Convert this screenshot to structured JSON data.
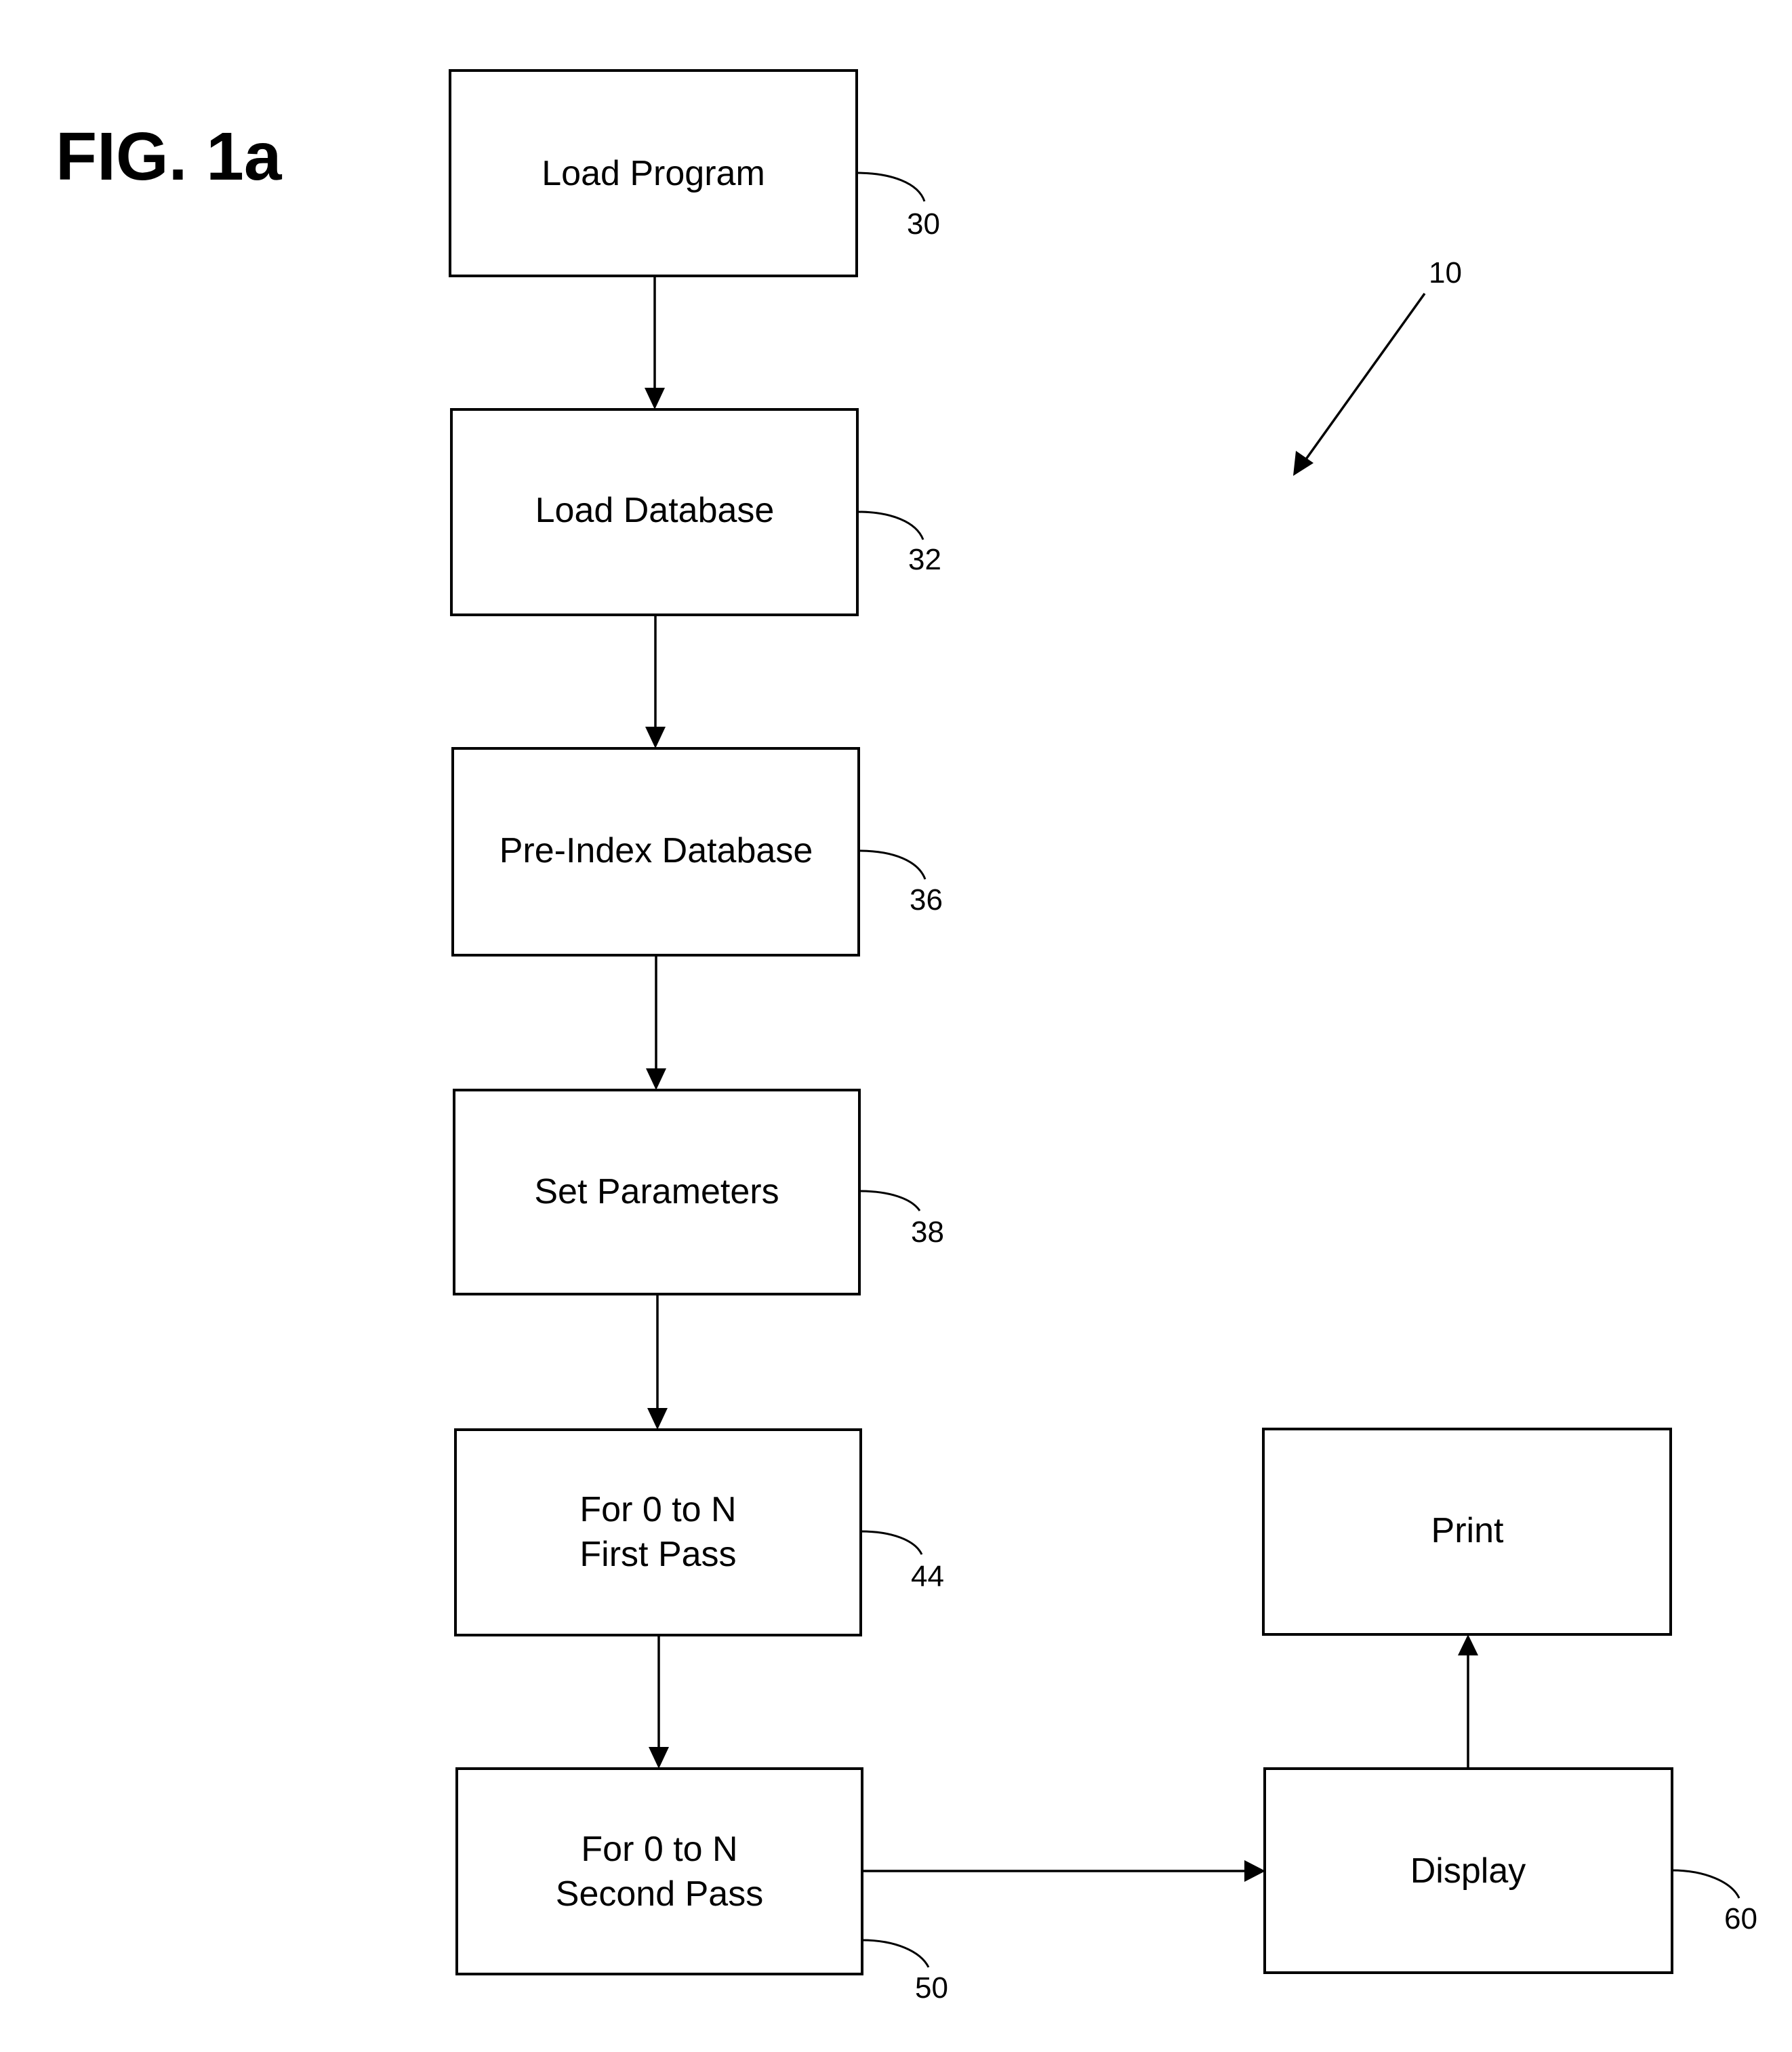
{
  "figure": {
    "title": "FIG. 1a",
    "reference": "10"
  },
  "nodes": [
    {
      "id": "load-program",
      "ref": "30",
      "lines": [
        "Load Program"
      ]
    },
    {
      "id": "load-database",
      "ref": "32",
      "lines": [
        "Load Database"
      ]
    },
    {
      "id": "pre-index-database",
      "ref": "36",
      "lines": [
        "Pre-Index Database"
      ]
    },
    {
      "id": "set-parameters",
      "ref": "38",
      "lines": [
        "Set Parameters"
      ]
    },
    {
      "id": "first-pass",
      "ref": "44",
      "lines": [
        "For 0 to N",
        "First Pass"
      ]
    },
    {
      "id": "second-pass",
      "ref": "50",
      "lines": [
        "For 0 to N",
        "Second Pass"
      ]
    },
    {
      "id": "display",
      "ref": "60",
      "lines": [
        "Display"
      ]
    },
    {
      "id": "print",
      "ref": "",
      "lines": [
        "Print"
      ]
    }
  ],
  "edges": [
    {
      "from": "load-program",
      "to": "load-database"
    },
    {
      "from": "load-database",
      "to": "pre-index-database"
    },
    {
      "from": "pre-index-database",
      "to": "set-parameters"
    },
    {
      "from": "set-parameters",
      "to": "first-pass"
    },
    {
      "from": "first-pass",
      "to": "second-pass"
    },
    {
      "from": "second-pass",
      "to": "display"
    },
    {
      "from": "display",
      "to": "print"
    }
  ]
}
